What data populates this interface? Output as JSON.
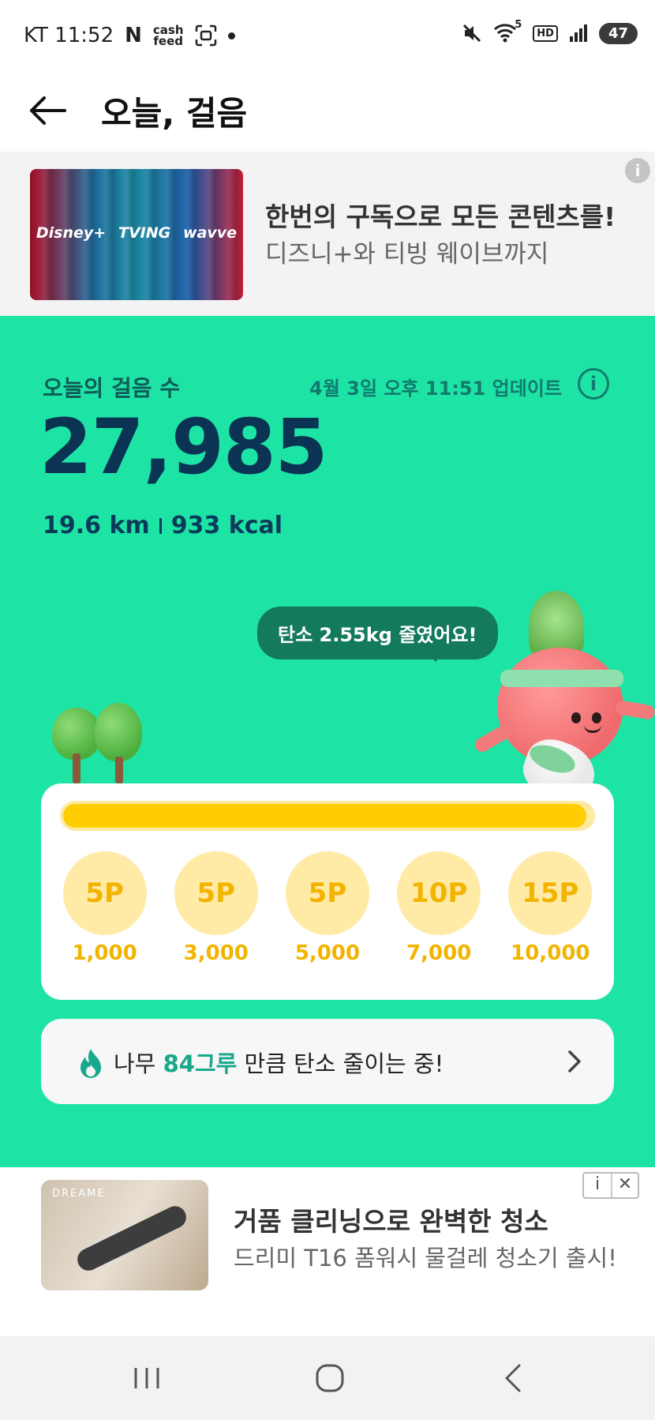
{
  "status_bar": {
    "carrier_time": "KT 11:52",
    "app_n": "N",
    "cashfeed_line1": "cash",
    "cashfeed_line2": "feed",
    "wifi_badge": "5",
    "hd": "HD",
    "battery": "47"
  },
  "header": {
    "title": "오늘, 걸음"
  },
  "ad_top": {
    "image_logos": [
      "Disney+",
      "TVING",
      "wavve"
    ],
    "title": "한번의 구독으로 모든 콘텐츠를!",
    "subtitle": "디즈니+와 티빙 웨이브까지",
    "info_icon": "i"
  },
  "steps": {
    "label": "오늘의 걸음 수",
    "update_time": "4월 3일 오후 11:51 업데이트",
    "info_icon": "i",
    "count": "27,985",
    "distance": "19.6 km",
    "calories": "933 kcal"
  },
  "carbon_bubble": "탄소 2.55kg 줄였어요!",
  "progress": {
    "fraction": 0.99,
    "milestones": [
      {
        "reward": "5P",
        "steps": "1,000"
      },
      {
        "reward": "5P",
        "steps": "3,000"
      },
      {
        "reward": "5P",
        "steps": "5,000"
      },
      {
        "reward": "10P",
        "steps": "7,000"
      },
      {
        "reward": "15P",
        "steps": "10,000"
      }
    ]
  },
  "carbon_banner": {
    "prefix": "나무 ",
    "highlight": "84그루",
    "suffix": " 만큼 탄소 줄이는 중!"
  },
  "ad_bottom": {
    "brand": "DREAME",
    "title": "거품 클리닝으로 완벽한 청소",
    "subtitle": "드리미 T16 폼워시 물걸레 청소기 출시!",
    "info": "i",
    "close": "✕"
  },
  "colors": {
    "green_bg": "#1de4a5",
    "dark_navy": "#0b3353",
    "yellow": "#ffcd00",
    "teal_accent": "#18a98c"
  }
}
